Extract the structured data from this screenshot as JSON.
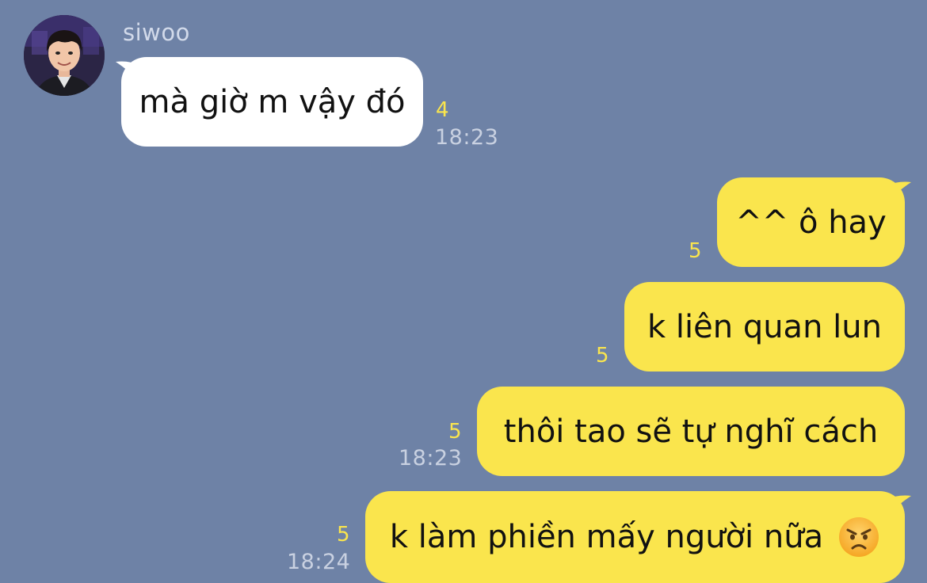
{
  "chat": {
    "sender": "siwoo",
    "incoming": {
      "text": "mà giờ m vậy đó",
      "unread_count": "4",
      "time": "18:23"
    },
    "outgoing": [
      {
        "text": "^^ ô hay",
        "unread_count": "5",
        "time": ""
      },
      {
        "text": "k liên quan lun",
        "unread_count": "5",
        "time": ""
      },
      {
        "text": "thôi tao sẽ tự nghĩ cách",
        "unread_count": "5",
        "time": "18:23"
      },
      {
        "text": "k làm phiền mấy người nữa",
        "unread_count": "5",
        "time": "18:24",
        "emoji": "angry-face"
      }
    ]
  },
  "colors": {
    "background": "#6e82a6",
    "incoming_bubble": "#ffffff",
    "outgoing_bubble": "#fae54d",
    "unread_count": "#fae54d",
    "timestamp": "#c9d1e1"
  }
}
